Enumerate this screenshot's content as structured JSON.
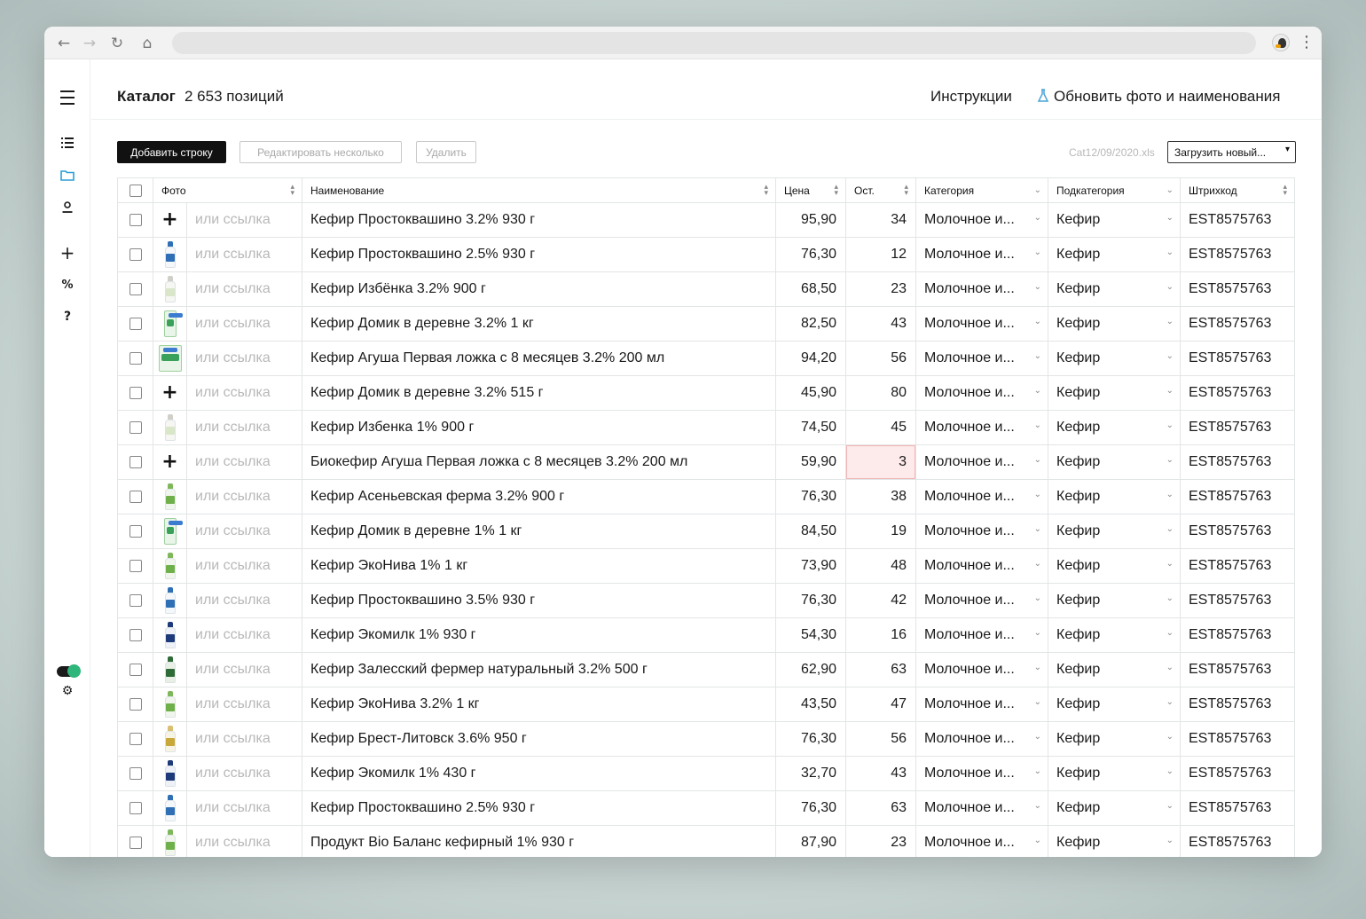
{
  "header": {
    "title": "Каталог",
    "count": "2 653 позиций",
    "instructions": "Инструкции",
    "refresh": "Обновить фото и наименования"
  },
  "toolbar": {
    "add": "Добавить строку",
    "edit_many": "Редактировать несколько",
    "delete": "Удалить",
    "file_name": "Cat12/09/2020.xls",
    "upload": "Загрузить новый..."
  },
  "columns": {
    "photo": "Фото",
    "name": "Наименование",
    "price": "Цена",
    "stock": "Ост.",
    "category": "Категория",
    "subcategory": "Подкатегория",
    "barcode": "Штрихкод"
  },
  "link_placeholder": "или ссылка",
  "rows": [
    {
      "photo": "add",
      "name": "Кефир Простоквашино 3.2% 930 г",
      "price": "95,90",
      "stock": "34",
      "category": "Молочное и...",
      "subcategory": "Кефир",
      "barcode": "EST8575763"
    },
    {
      "photo": "bottle-blue",
      "name": "Кефир Простоквашино 2.5% 930 г",
      "price": "76,30",
      "stock": "12",
      "category": "Молочное и...",
      "subcategory": "Кефир",
      "barcode": "EST8575763"
    },
    {
      "photo": "bottle-white",
      "name": "Кефир Избёнка 3.2% 900 г",
      "price": "68,50",
      "stock": "23",
      "category": "Молочное и...",
      "subcategory": "Кефир",
      "barcode": "EST8575763"
    },
    {
      "photo": "pack-green",
      "name": "Кефир Домик в деревне 3.2% 1 кг",
      "price": "82,50",
      "stock": "43",
      "category": "Молочное и...",
      "subcategory": "Кефир",
      "barcode": "EST8575763"
    },
    {
      "photo": "pack-agusha",
      "name": "Кефир Агуша Первая ложка с 8 месяцев 3.2% 200 мл",
      "price": "94,20",
      "stock": "56",
      "category": "Молочное и...",
      "subcategory": "Кефир",
      "barcode": "EST8575763"
    },
    {
      "photo": "add",
      "name": "Кефир Домик в деревне 3.2% 515 г",
      "price": "45,90",
      "stock": "80",
      "category": "Молочное и...",
      "subcategory": "Кефир",
      "barcode": "EST8575763"
    },
    {
      "photo": "bottle-white",
      "name": "Кефир Избенка 1% 900 г",
      "price": "74,50",
      "stock": "45",
      "category": "Молочное и...",
      "subcategory": "Кефир",
      "barcode": "EST8575763"
    },
    {
      "photo": "add",
      "name": "Биокефир Агуша Первая ложка с 8 месяцев 3.2% 200 мл",
      "price": "59,90",
      "stock": "3",
      "low_stock": true,
      "category": "Молочное и...",
      "subcategory": "Кефир",
      "barcode": "EST8575763"
    },
    {
      "photo": "bottle-green",
      "name": "Кефир Асеньевская ферма 3.2% 900 г",
      "price": "76,30",
      "stock": "38",
      "category": "Молочное и...",
      "subcategory": "Кефир",
      "barcode": "EST8575763"
    },
    {
      "photo": "pack-green",
      "name": "Кефир Домик в деревне 1% 1 кг",
      "price": "84,50",
      "stock": "19",
      "category": "Молочное и...",
      "subcategory": "Кефир",
      "barcode": "EST8575763"
    },
    {
      "photo": "bottle-green",
      "name": "Кефир ЭкоНива 1% 1 кг",
      "price": "73,90",
      "stock": "48",
      "category": "Молочное и...",
      "subcategory": "Кефир",
      "barcode": "EST8575763"
    },
    {
      "photo": "bottle-blue",
      "name": "Кефир Простоквашино 3.5% 930 г",
      "price": "76,30",
      "stock": "42",
      "category": "Молочное и...",
      "subcategory": "Кефир",
      "barcode": "EST8575763"
    },
    {
      "photo": "bottle-navy",
      "name": "Кефир Экомилк 1% 930 г",
      "price": "54,30",
      "stock": "16",
      "category": "Молочное и...",
      "subcategory": "Кефир",
      "barcode": "EST8575763"
    },
    {
      "photo": "bottle-darkgreen",
      "name": "Кефир Залесский фермер натуральный 3.2% 500 г",
      "price": "62,90",
      "stock": "63",
      "category": "Молочное и...",
      "subcategory": "Кефир",
      "barcode": "EST8575763"
    },
    {
      "photo": "bottle-green",
      "name": "Кефир ЭкоНива 3.2% 1 кг",
      "price": "43,50",
      "stock": "47",
      "category": "Молочное и...",
      "subcategory": "Кефир",
      "barcode": "EST8575763"
    },
    {
      "photo": "bottle-yellow",
      "name": "Кефир Брест-Литовск 3.6% 950 г",
      "price": "76,30",
      "stock": "56",
      "category": "Молочное и...",
      "subcategory": "Кефир",
      "barcode": "EST8575763"
    },
    {
      "photo": "bottle-navy",
      "name": "Кефир Экомилк 1% 430 г",
      "price": "32,70",
      "stock": "43",
      "category": "Молочное и...",
      "subcategory": "Кефир",
      "barcode": "EST8575763"
    },
    {
      "photo": "bottle-blue",
      "name": "Кефир Простоквашино 2.5% 930 г",
      "price": "76,30",
      "stock": "63",
      "category": "Молочное и...",
      "subcategory": "Кефир",
      "barcode": "EST8575763"
    },
    {
      "photo": "bottle-green",
      "name": "Продукт Bio Баланс кефирный 1% 930 г",
      "price": "87,90",
      "stock": "23",
      "category": "Молочное и...",
      "subcategory": "Кефир",
      "barcode": "EST8575763"
    }
  ],
  "colors": {
    "accent": "#2fb67a",
    "primary_button": "#111111",
    "low_stock_bg": "#fdeaea",
    "refresh_icon": "#4aa3d8"
  },
  "icons": {
    "sidebar": [
      "hamburger-icon",
      "list-icon",
      "folder-icon",
      "user-icon",
      "plus-icon",
      "percent-icon",
      "help-icon",
      "theme-toggle",
      "gear-icon"
    ]
  }
}
